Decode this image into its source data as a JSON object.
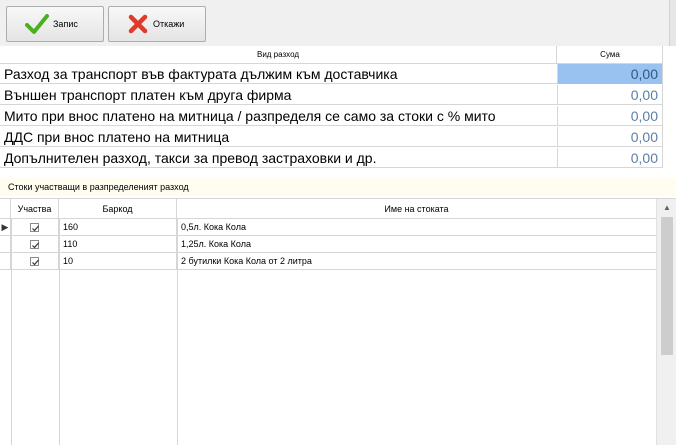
{
  "toolbar": {
    "save_label": "Запис",
    "cancel_label": "Откажи",
    "save_icon": "checkmark-icon",
    "cancel_icon": "x-icon",
    "save_icon_color": "#4caf1f",
    "cancel_icon_color": "#e03a2a"
  },
  "expenses": {
    "col_name": "Вид разход",
    "col_amount": "Сума",
    "rows": [
      {
        "name": "Разход за транспорт във фактурата дължим към доставчика",
        "amount": "0,00"
      },
      {
        "name": "Външен транспорт платен към друга фирма",
        "amount": "0,00"
      },
      {
        "name": "Мито при внос платено на митница / разпределя се само за стоки с % мито",
        "amount": "0,00"
      },
      {
        "name": "ДДС при внос платено на митница",
        "amount": "0,00"
      },
      {
        "name": "Допълнителен разход, такси за превод застраховки и др.",
        "amount": "0,00"
      }
    ]
  },
  "goods": {
    "group_label": "Стоки участващи в разпределеният разход",
    "col_participates": "Участва",
    "col_barcode": "Баркод",
    "col_name": "Име на стоката",
    "rows": [
      {
        "checked": true,
        "barcode": "160",
        "name": "0,5л. Кока Кола"
      },
      {
        "checked": true,
        "barcode": "110",
        "name": "1,25л.  Кока Кола"
      },
      {
        "checked": true,
        "barcode": "10",
        "name": "2 бутилки Кока Кола от 2 литра"
      }
    ]
  }
}
